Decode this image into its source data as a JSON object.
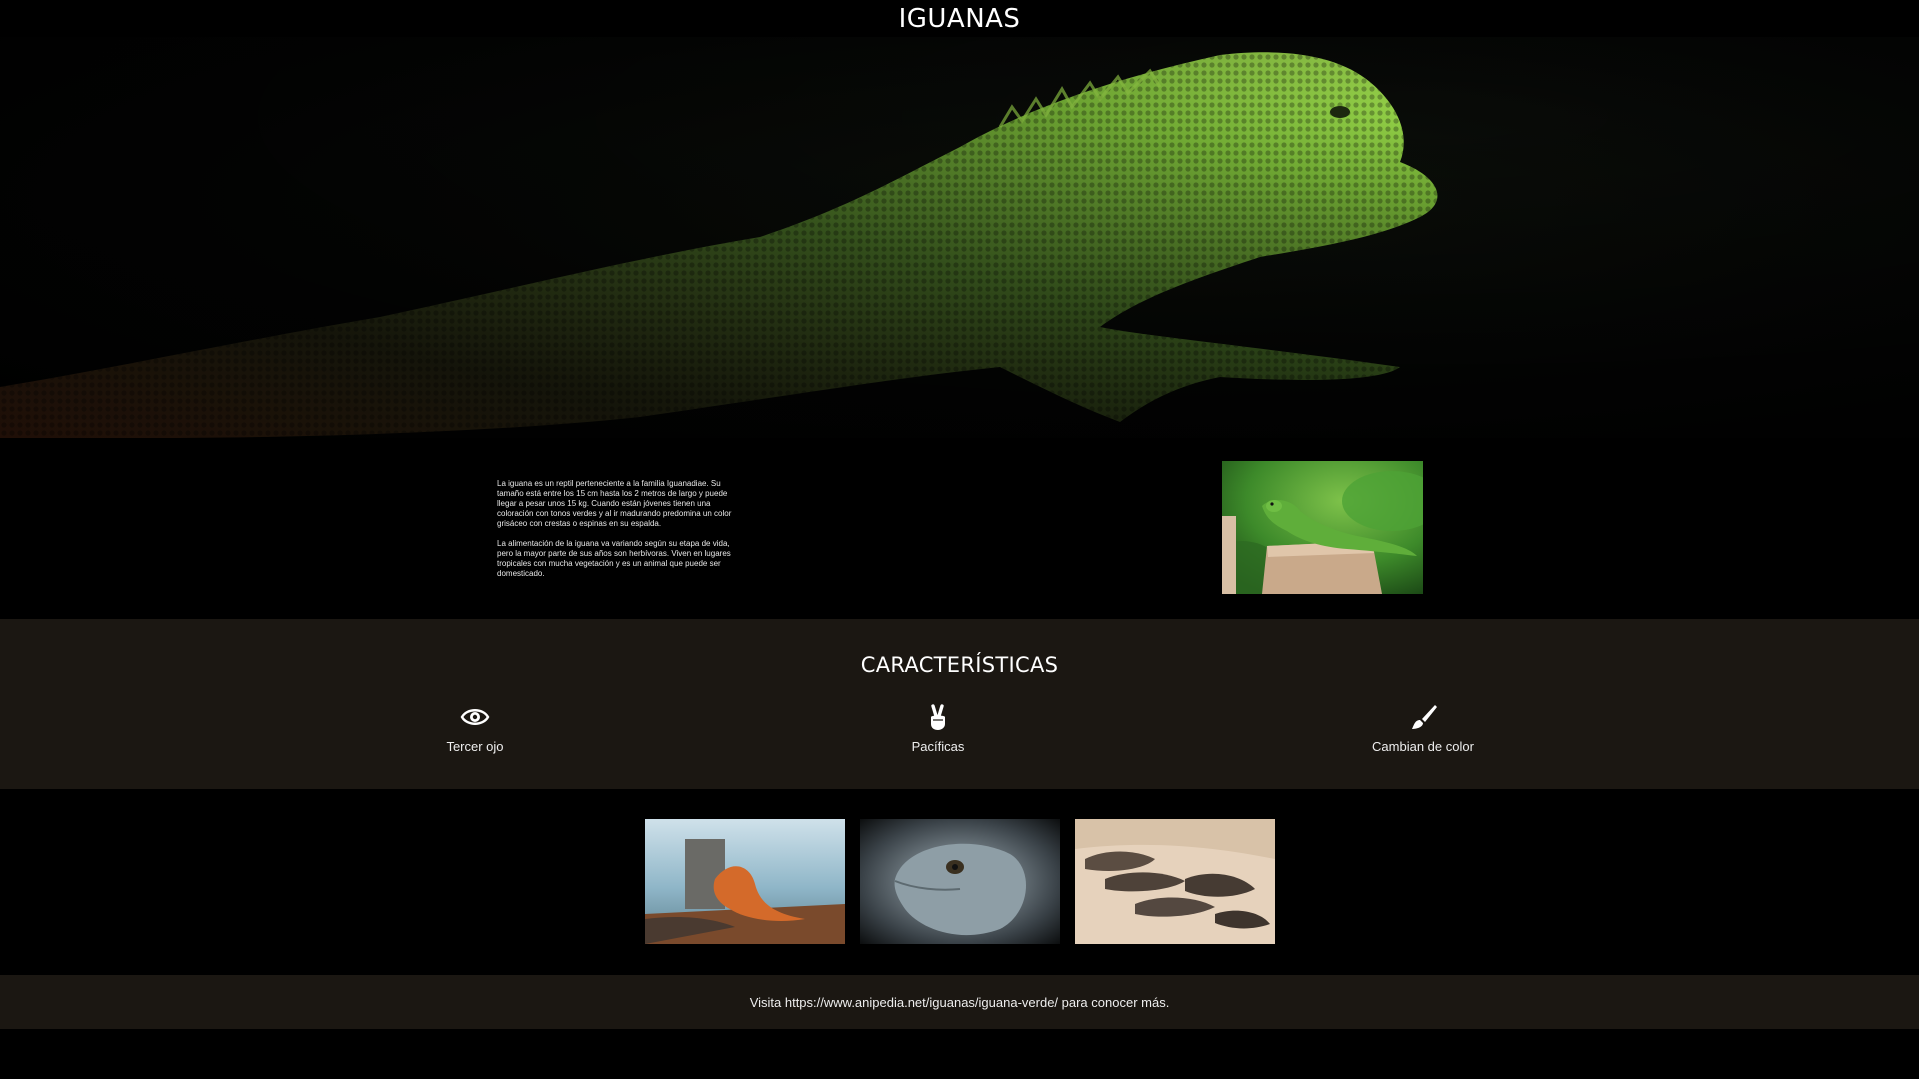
{
  "header": {
    "title": "IGUANAS"
  },
  "intro": {
    "paragraphs": [
      "La iguana es un reptil perteneciente a la familia Iguanadiae. Su tamaño está entre los 15 cm hasta los 2 metros de largo y puede llegar a pesar unos 15 kg. Cuando están jóvenes tienen una coloración con tonos verdes y al ir madurando predomina un color grisáceo con crestas o espinas en su espalda.",
      "La alimentación de la iguana va variando según su etapa de vida, pero la mayor parte de sus años son herbívoras. Viven en lugares tropicales con mucha vegetación y es un animal que puede ser domesticado."
    ]
  },
  "features": {
    "title": "CARACTERÍSTICAS",
    "items": [
      {
        "label": "Tercer ojo",
        "icon": "eye-icon"
      },
      {
        "label": "Pacíficas",
        "icon": "peace-hand-icon"
      },
      {
        "label": "Cambian de color",
        "icon": "paintbrush-icon"
      }
    ]
  },
  "footer": {
    "text": "Visita https://www.anipedia.net/iguanas/iguana-verde/ para conocer más."
  },
  "colors": {
    "background": "#000000",
    "section_dark_brown": "#1b1712",
    "text": "#ffffff"
  }
}
